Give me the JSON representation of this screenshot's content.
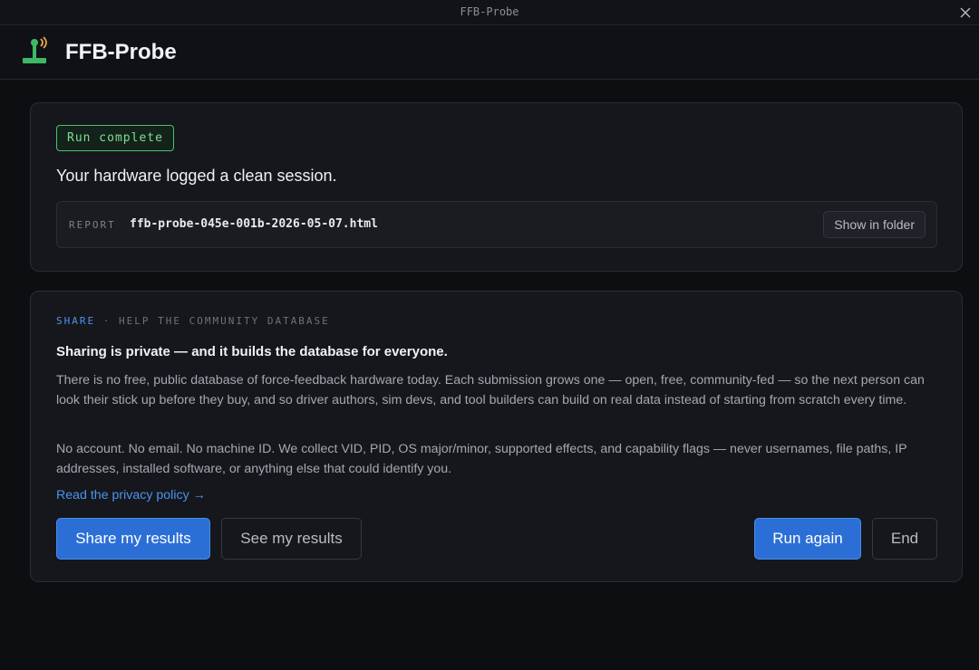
{
  "window": {
    "title": "FFB-Probe"
  },
  "header": {
    "app_title": "FFB-Probe",
    "logo_icon": "joystick-signal-icon"
  },
  "result": {
    "badge": "Run complete",
    "headline": "Your hardware logged a clean session.",
    "report_label": "REPORT",
    "report_file": "ffb-probe-045e-001b-2026-05-07.html",
    "show_folder_label": "Show in folder"
  },
  "share": {
    "label_accent": "SHARE",
    "label_rest": " · HELP THE COMMUNITY DATABASE",
    "title": "Sharing is private — and it builds the database for everyone.",
    "para1": "There is no free, public database of force-feedback hardware today. Each submission grows one — open, free, community-fed — so the next person can look their stick up before they buy, and so driver authors, sim devs, and tool builders can build on real data instead of starting from scratch every time.",
    "para2": "No account. No email. No machine ID. We collect VID, PID, OS major/minor, supported effects, and capability flags — never usernames, file paths, IP addresses, installed software, or anything else that could identify you.",
    "privacy_link": "Read the privacy policy",
    "privacy_arrow": "→",
    "buttons": {
      "share": "Share my results",
      "see": "See my results",
      "run_again": "Run again",
      "end": "End"
    }
  },
  "colors": {
    "accent_blue": "#2b6fd6",
    "success_green": "#4fbf6a",
    "background": "#0d0e12"
  }
}
